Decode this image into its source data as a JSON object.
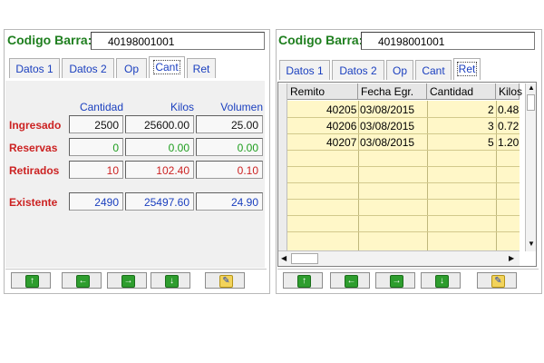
{
  "left": {
    "code_label": "Codigo Barra:",
    "code_value": "40198001001",
    "tabs": [
      "Datos 1",
      "Datos 2",
      "Op",
      "Cant",
      "Ret"
    ],
    "active_tab": "Cant",
    "columns": [
      "Cantidad",
      "Kilos",
      "Volumen"
    ],
    "rows": [
      {
        "label": "Ingresado",
        "cantidad": "2500",
        "kilos": "25600.00",
        "volumen": "25.00",
        "color": "#cc2222",
        "value_color": "#111111"
      },
      {
        "label": "Reservas",
        "cantidad": "0",
        "kilos": "0.00",
        "volumen": "0.00",
        "color": "#cc2222",
        "value_color": "#1e9e1e"
      },
      {
        "label": "Retirados",
        "cantidad": "10",
        "kilos": "102.40",
        "volumen": "0.10",
        "color": "#cc2222",
        "value_color": "#cc2222"
      },
      {
        "label": "Existente",
        "cantidad": "2490",
        "kilos": "25497.60",
        "volumen": "24.90",
        "color": "#cc2222",
        "value_color": "#1a3fbf"
      }
    ]
  },
  "right": {
    "code_label": "Codigo Barra:",
    "code_value": "40198001001",
    "tabs": [
      "Datos 1",
      "Datos 2",
      "Op",
      "Cant",
      "Ret"
    ],
    "active_tab": "Ret",
    "grid_headers": [
      "Remito",
      "Fecha Egr.",
      "Cantidad",
      "Kilos"
    ],
    "grid_rows": [
      {
        "remito": "40205",
        "fecha": "03/08/2015",
        "cantidad": "2",
        "kilos": "0.48"
      },
      {
        "remito": "40206",
        "fecha": "03/08/2015",
        "cantidad": "3",
        "kilos": "0.72"
      },
      {
        "remito": "40207",
        "fecha": "03/08/2015",
        "cantidad": "5",
        "kilos": "1.20"
      }
    ]
  },
  "nav_buttons": [
    "arrow-up-icon",
    "arrow-left-icon",
    "arrow-right-icon",
    "arrow-down-icon",
    "edit-icon"
  ],
  "colors": {
    "label_green": "#1f7f1f",
    "tab_blue": "#1a3fbf",
    "red": "#cc2222",
    "grid_yellow": "#fff7c8"
  }
}
